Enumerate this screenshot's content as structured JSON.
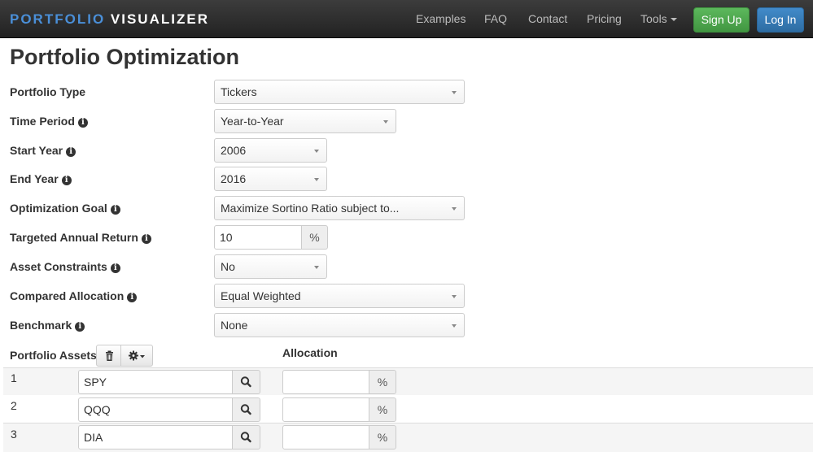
{
  "navbar": {
    "brand_part1": "PORTFOLIO",
    "brand_part2": "VISUALIZER",
    "links": {
      "examples": "Examples",
      "faq": "FAQ",
      "contact": "Contact",
      "pricing": "Pricing",
      "tools": "Tools"
    },
    "sign_up": "Sign Up",
    "log_in": "Log In"
  },
  "page": {
    "title": "Portfolio Optimization"
  },
  "form": {
    "portfolio_type": {
      "label": "Portfolio Type",
      "value": "Tickers"
    },
    "time_period": {
      "label": "Time Period",
      "value": "Year-to-Year"
    },
    "start_year": {
      "label": "Start Year",
      "value": "2006"
    },
    "end_year": {
      "label": "End Year",
      "value": "2016"
    },
    "optimization_goal": {
      "label": "Optimization Goal",
      "value": "Maximize Sortino Ratio subject to..."
    },
    "targeted_annual_return": {
      "label": "Targeted Annual Return",
      "value": "10",
      "unit": "%"
    },
    "asset_constraints": {
      "label": "Asset Constraints",
      "value": "No"
    },
    "compared_allocation": {
      "label": "Compared Allocation",
      "value": "Equal Weighted"
    },
    "benchmark": {
      "label": "Benchmark",
      "value": "None"
    }
  },
  "assets": {
    "header": "Portfolio Assets",
    "allocation_header": "Allocation",
    "rows": [
      {
        "num": "1",
        "ticker": "SPY",
        "allocation": "",
        "unit": "%"
      },
      {
        "num": "2",
        "ticker": "QQQ",
        "allocation": "",
        "unit": "%"
      },
      {
        "num": "3",
        "ticker": "DIA",
        "allocation": "",
        "unit": "%"
      }
    ]
  },
  "icons": {
    "info": "info-icon",
    "trash": "trash-icon",
    "gear": "gear-icon",
    "search": "search-icon"
  }
}
